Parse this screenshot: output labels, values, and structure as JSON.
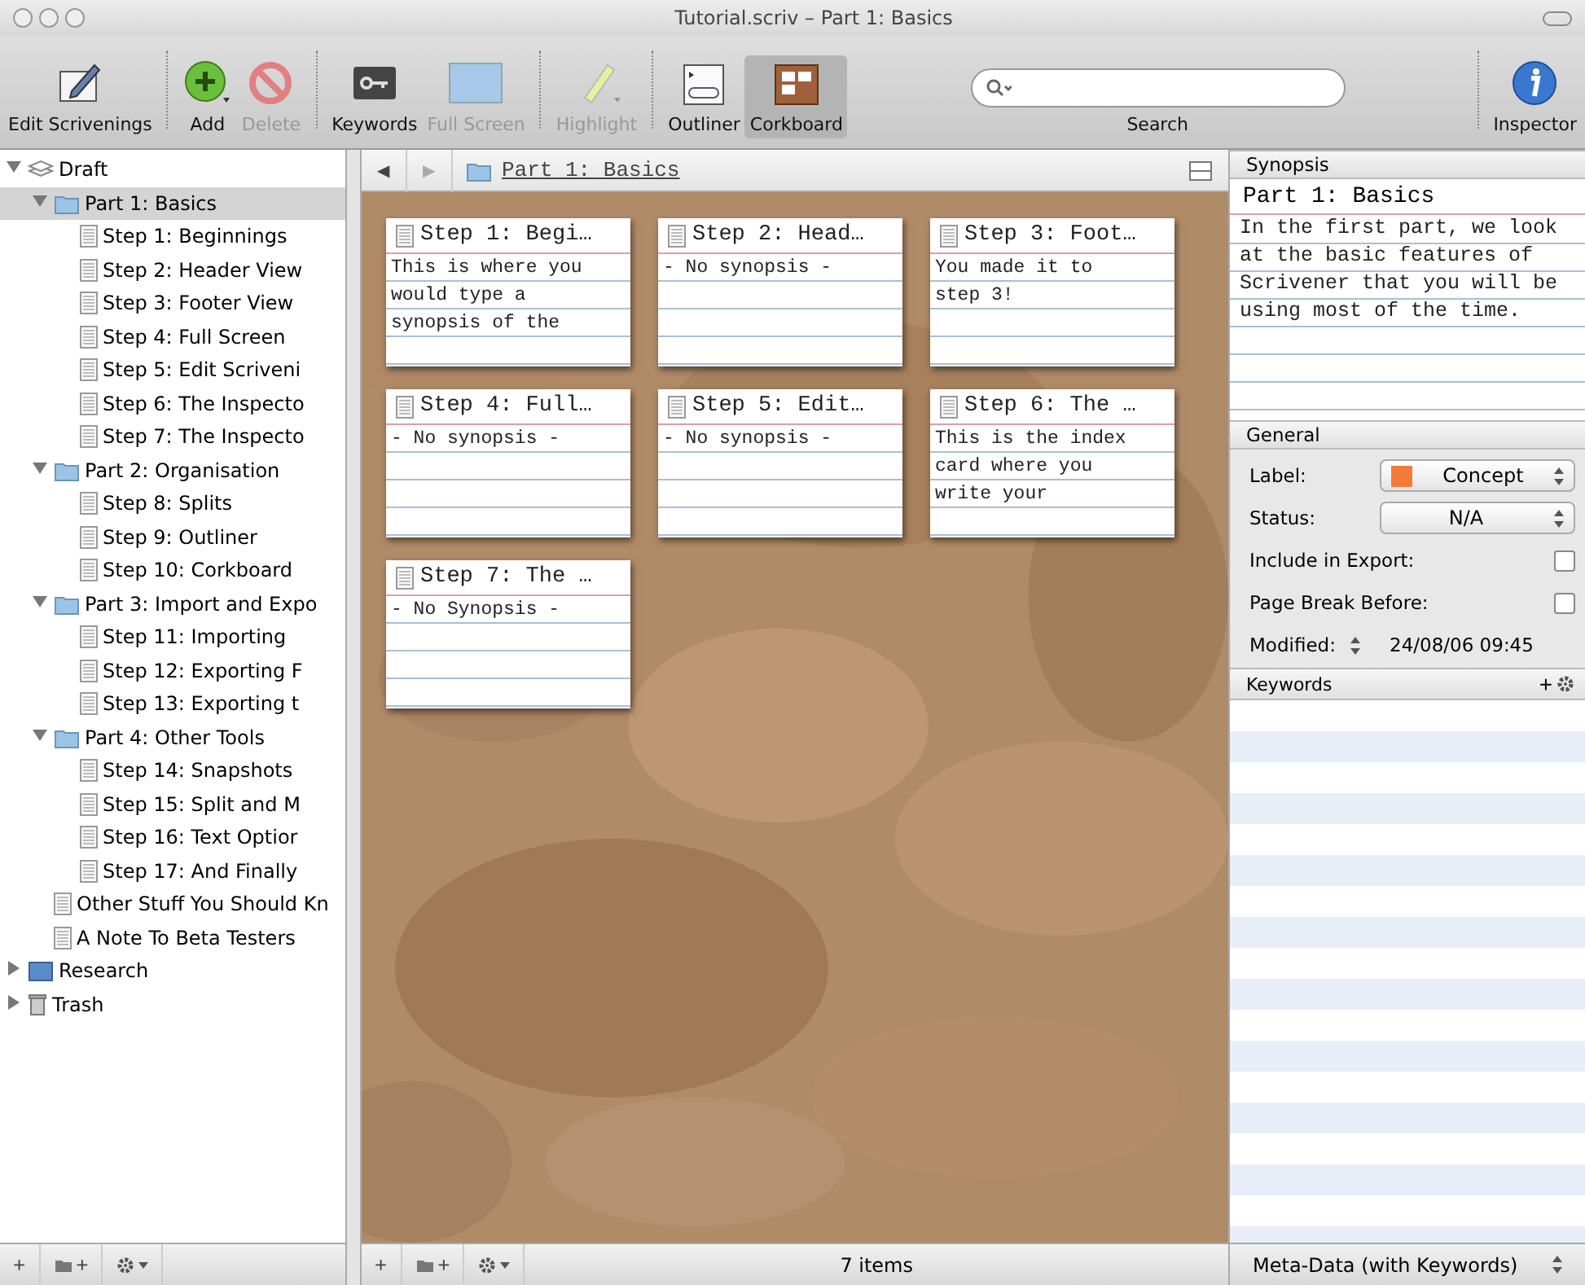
{
  "window": {
    "title": "Tutorial.scriv – Part 1: Basics"
  },
  "toolbar": [
    {
      "kind": "edit",
      "label": "Edit Scrivenings",
      "disabled": false,
      "selected": false
    },
    {
      "kind": "add",
      "label": "Add",
      "disabled": false,
      "selected": false
    },
    {
      "kind": "delete",
      "label": "Delete",
      "disabled": true,
      "selected": false
    },
    {
      "kind": "keywords",
      "label": "Keywords",
      "disabled": false,
      "selected": false
    },
    {
      "kind": "fullscreen",
      "label": "Full Screen",
      "disabled": true,
      "selected": false
    },
    {
      "kind": "highlight",
      "label": "Highlight",
      "disabled": true,
      "selected": false
    },
    {
      "kind": "outliner",
      "label": "Outliner",
      "disabled": false,
      "selected": false
    },
    {
      "kind": "corkboard",
      "label": "Corkboard",
      "disabled": false,
      "selected": true
    },
    {
      "kind": "search",
      "label": "Search",
      "disabled": false,
      "selected": false
    },
    {
      "kind": "inspector",
      "label": "Inspector",
      "disabled": false,
      "selected": false
    }
  ],
  "binder": [
    {
      "kind": "draft",
      "label": "Draft",
      "expanded": true,
      "selected": false,
      "children": [
        {
          "kind": "folder",
          "label": "Part 1: Basics",
          "expanded": true,
          "selected": true,
          "children": [
            {
              "kind": "doc",
              "label": "Step 1: Beginnings",
              "selected": false
            },
            {
              "kind": "doc",
              "label": "Step 2: Header View",
              "selected": false
            },
            {
              "kind": "doc",
              "label": "Step 3: Footer View",
              "selected": false
            },
            {
              "kind": "doc",
              "label": "Step 4: Full Screen",
              "selected": false
            },
            {
              "kind": "doc",
              "label": "Step 5: Edit Scriveni",
              "selected": false
            },
            {
              "kind": "doc",
              "label": "Step 6: The Inspecto",
              "selected": false
            },
            {
              "kind": "doc",
              "label": "Step 7: The Inspecto",
              "selected": false
            }
          ]
        },
        {
          "kind": "folder",
          "label": "Part 2: Organisation",
          "expanded": true,
          "selected": false,
          "children": [
            {
              "kind": "doc",
              "label": "Step 8: Splits",
              "selected": false
            },
            {
              "kind": "doc",
              "label": "Step 9: Outliner",
              "selected": false
            },
            {
              "kind": "doc",
              "label": "Step 10: Corkboard",
              "selected": false
            }
          ]
        },
        {
          "kind": "folder",
          "label": "Part 3: Import and Expo",
          "expanded": true,
          "selected": false,
          "children": [
            {
              "kind": "doc",
              "label": "Step 11: Importing",
              "selected": false
            },
            {
              "kind": "doc",
              "label": "Step 12: Exporting F",
              "selected": false
            },
            {
              "kind": "doc",
              "label": "Step 13: Exporting t",
              "selected": false
            }
          ]
        },
        {
          "kind": "folder",
          "label": "Part 4: Other Tools",
          "expanded": true,
          "selected": false,
          "children": [
            {
              "kind": "doc",
              "label": "Step 14: Snapshots",
              "selected": false
            },
            {
              "kind": "doc",
              "label": "Step 15: Split and M",
              "selected": false
            },
            {
              "kind": "doc",
              "label": "Step 16: Text Optior",
              "selected": false
            },
            {
              "kind": "doc",
              "label": "Step 17: And Finally",
              "selected": false
            }
          ]
        },
        {
          "kind": "doc",
          "label": "Other Stuff You Should Kn",
          "selected": false
        },
        {
          "kind": "doc",
          "label": "A Note To Beta Testers",
          "selected": false
        }
      ]
    },
    {
      "kind": "research",
      "label": "Research",
      "expanded": false,
      "selected": false
    },
    {
      "kind": "trash",
      "label": "Trash",
      "expanded": false,
      "selected": false
    }
  ],
  "corkboard": {
    "back": "◀",
    "forward": "▶",
    "title": "Part 1: Basics",
    "status": "7 items",
    "cards": [
      {
        "title": "Step 1: Begi…",
        "synopsis": [
          "This is where you",
          "would type a",
          "synopsis of the"
        ]
      },
      {
        "title": "Step 2: Head…",
        "synopsis": [
          "- No synopsis -"
        ]
      },
      {
        "title": "Step 3: Foot…",
        "synopsis": [
          "You made it to",
          "step 3!"
        ]
      },
      {
        "title": "Step 4: Full…",
        "synopsis": [
          "- No synopsis -"
        ]
      },
      {
        "title": "Step 5: Edit…",
        "synopsis": [
          "- No synopsis -"
        ]
      },
      {
        "title": "Step 6: The …",
        "synopsis": [
          "This is the index",
          "card where you",
          "write your"
        ]
      },
      {
        "title": "Step 7: The …",
        "synopsis": [
          "- No Synopsis -"
        ]
      }
    ]
  },
  "inspector": {
    "synopsis_header": "Synopsis",
    "title": "Part 1: Basics",
    "synopsis": [
      "In the first part, we look",
      "at the basic features of",
      "Scrivener that you will be",
      "using most of the time."
    ],
    "general_header": "General",
    "label": {
      "caption": "Label:",
      "value": "Concept",
      "color": "#f47a3c"
    },
    "status": {
      "caption": "Status:",
      "value": "N/A"
    },
    "checks": [
      {
        "label": "Include in Export:",
        "checked": false
      },
      {
        "label": "Page Break Before:",
        "checked": false
      }
    ],
    "modified": {
      "caption": "Modified:",
      "value": "24/08/06 09:45"
    },
    "keywords_header": "Keywords",
    "keywords_add": "+",
    "footer": "Meta-Data (with Keywords)"
  },
  "footer_buttons": [
    "+"
  ]
}
